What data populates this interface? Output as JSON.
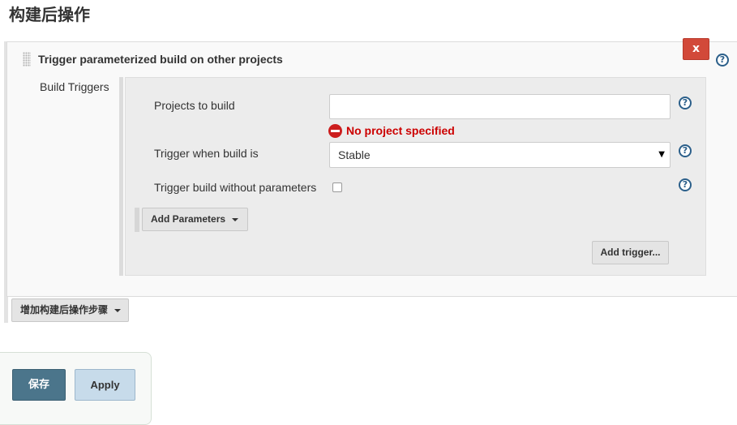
{
  "section": {
    "title": "构建后操作"
  },
  "step": {
    "title": "Trigger parameterized build on other projects",
    "delete_label": "x",
    "help_glyph": "?"
  },
  "build_triggers": {
    "label": "Build Triggers",
    "projects_to_build": {
      "label": "Projects to build",
      "value": "",
      "error": "No project specified"
    },
    "trigger_when": {
      "label": "Trigger when build is",
      "selected": "Stable",
      "arrow": "▼"
    },
    "without_params": {
      "label": "Trigger build without parameters",
      "checked": false
    },
    "add_parameters_label": "Add Parameters",
    "add_trigger_label": "Add trigger..."
  },
  "add_post_build_step_label": "增加构建后操作步骤",
  "footer": {
    "save_label": "保存",
    "apply_label": "Apply"
  },
  "colors": {
    "delete": "#d24939",
    "error": "#cc0000",
    "save": "#4b758b",
    "apply": "#c7dbea",
    "help": "#2b5f8a"
  }
}
